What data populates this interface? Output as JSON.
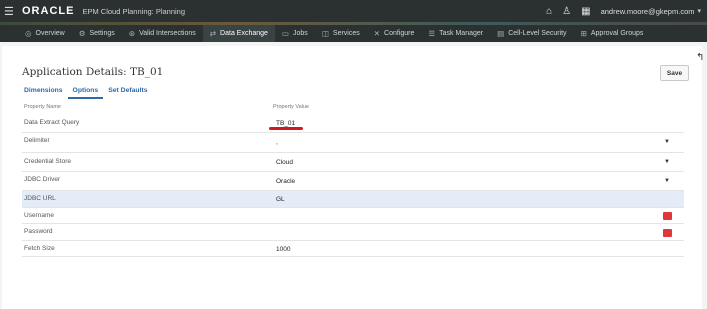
{
  "header": {
    "logo": "ORACLE",
    "app_title": "EPM Cloud Planning: Planning",
    "user": "andrew.moore@gkepm.com"
  },
  "nav": {
    "items": [
      {
        "label": "Overview",
        "icon": "overview-icon"
      },
      {
        "label": "Settings",
        "icon": "gear-icon"
      },
      {
        "label": "Valid Intersections",
        "icon": "intersection-icon"
      },
      {
        "label": "Data Exchange",
        "icon": "exchange-icon"
      },
      {
        "label": "Jobs",
        "icon": "calendar-icon"
      },
      {
        "label": "Services",
        "icon": "services-icon"
      },
      {
        "label": "Configure",
        "icon": "wrench-icon"
      },
      {
        "label": "Task Manager",
        "icon": "task-icon"
      },
      {
        "label": "Cell-Level Security",
        "icon": "security-icon"
      },
      {
        "label": "Approval Groups",
        "icon": "approval-icon"
      }
    ]
  },
  "page": {
    "title": "Application Details: TB_01",
    "save_label": "Save"
  },
  "tabs": [
    {
      "label": "Dimensions"
    },
    {
      "label": "Options"
    },
    {
      "label": "Set Defaults"
    }
  ],
  "table": {
    "col_name": "Property Name",
    "col_value": "Property Value",
    "rows": [
      {
        "name": "Data Extract Query",
        "value": "TB_01"
      },
      {
        "name": "Delimiter",
        "value": ","
      },
      {
        "name": "Credential Store",
        "value": "Cloud"
      },
      {
        "name": "JDBC Driver",
        "value": "Oracle"
      },
      {
        "name": "JDBC URL",
        "value": "GL"
      },
      {
        "name": "Username",
        "value": ""
      },
      {
        "name": "Password",
        "value": ""
      },
      {
        "name": "Fetch Size",
        "value": "1000"
      }
    ]
  }
}
